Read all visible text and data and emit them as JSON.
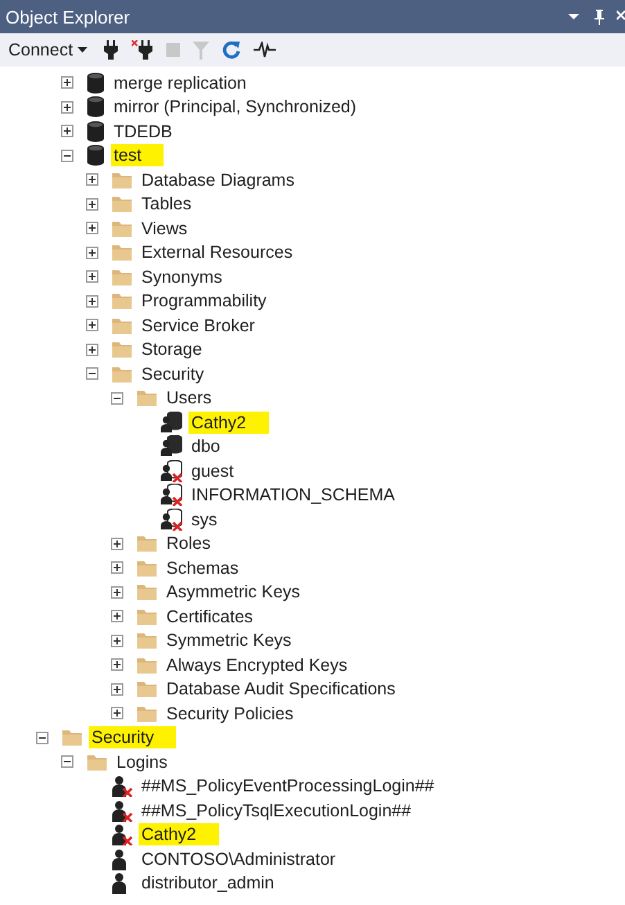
{
  "window": {
    "title": "Object Explorer"
  },
  "toolbar": {
    "connect_label": "Connect"
  },
  "database_nodes": [
    {
      "label": "merge replication",
      "kind": "database",
      "expanded": false,
      "highlighted": false
    },
    {
      "label": "mirror (Principal, Synchronized)",
      "kind": "database",
      "expanded": false,
      "highlighted": false
    },
    {
      "label": "TDEDB",
      "kind": "database",
      "expanded": false,
      "highlighted": false
    },
    {
      "label": "test",
      "kind": "database",
      "expanded": true,
      "highlighted": true,
      "children": [
        {
          "label": "Database Diagrams",
          "kind": "folder",
          "expanded": false,
          "highlighted": false
        },
        {
          "label": "Tables",
          "kind": "folder",
          "expanded": false,
          "highlighted": false
        },
        {
          "label": "Views",
          "kind": "folder",
          "expanded": false,
          "highlighted": false
        },
        {
          "label": "External Resources",
          "kind": "folder",
          "expanded": false,
          "highlighted": false
        },
        {
          "label": "Synonyms",
          "kind": "folder",
          "expanded": false,
          "highlighted": false
        },
        {
          "label": "Programmability",
          "kind": "folder",
          "expanded": false,
          "highlighted": false
        },
        {
          "label": "Service Broker",
          "kind": "folder",
          "expanded": false,
          "highlighted": false
        },
        {
          "label": "Storage",
          "kind": "folder",
          "expanded": false,
          "highlighted": false
        },
        {
          "label": "Security",
          "kind": "folder",
          "expanded": true,
          "highlighted": false,
          "children": [
            {
              "label": "Users",
              "kind": "folder",
              "expanded": true,
              "highlighted": false,
              "children": [
                {
                  "label": "Cathy2",
                  "kind": "user",
                  "highlighted": true
                },
                {
                  "label": "dbo",
                  "kind": "user",
                  "highlighted": false
                },
                {
                  "label": "guest",
                  "kind": "user-disabled",
                  "highlighted": false
                },
                {
                  "label": "INFORMATION_SCHEMA",
                  "kind": "user-disabled",
                  "highlighted": false
                },
                {
                  "label": "sys",
                  "kind": "user-disabled",
                  "highlighted": false
                }
              ]
            },
            {
              "label": "Roles",
              "kind": "folder",
              "expanded": false,
              "highlighted": false
            },
            {
              "label": "Schemas",
              "kind": "folder",
              "expanded": false,
              "highlighted": false
            },
            {
              "label": "Asymmetric Keys",
              "kind": "folder",
              "expanded": false,
              "highlighted": false
            },
            {
              "label": "Certificates",
              "kind": "folder",
              "expanded": false,
              "highlighted": false
            },
            {
              "label": "Symmetric Keys",
              "kind": "folder",
              "expanded": false,
              "highlighted": false
            },
            {
              "label": "Always Encrypted Keys",
              "kind": "folder",
              "expanded": false,
              "highlighted": false
            },
            {
              "label": "Database Audit Specifications",
              "kind": "folder",
              "expanded": false,
              "highlighted": false
            },
            {
              "label": "Security Policies",
              "kind": "folder",
              "expanded": false,
              "highlighted": false
            }
          ]
        }
      ]
    }
  ],
  "server_nodes": [
    {
      "label": "Security",
      "kind": "folder",
      "expanded": true,
      "highlighted": true,
      "children": [
        {
          "label": "Logins",
          "kind": "folder",
          "expanded": true,
          "highlighted": false,
          "children": [
            {
              "label": "##MS_PolicyEventProcessingLogin##",
              "kind": "login-disabled",
              "highlighted": false
            },
            {
              "label": "##MS_PolicyTsqlExecutionLogin##",
              "kind": "login-disabled",
              "highlighted": false
            },
            {
              "label": "Cathy2",
              "kind": "login-disabled",
              "highlighted": true
            },
            {
              "label": "CONTOSO\\Administrator",
              "kind": "login",
              "highlighted": false
            },
            {
              "label": "distributor_admin",
              "kind": "login",
              "highlighted": false
            }
          ]
        }
      ]
    }
  ]
}
